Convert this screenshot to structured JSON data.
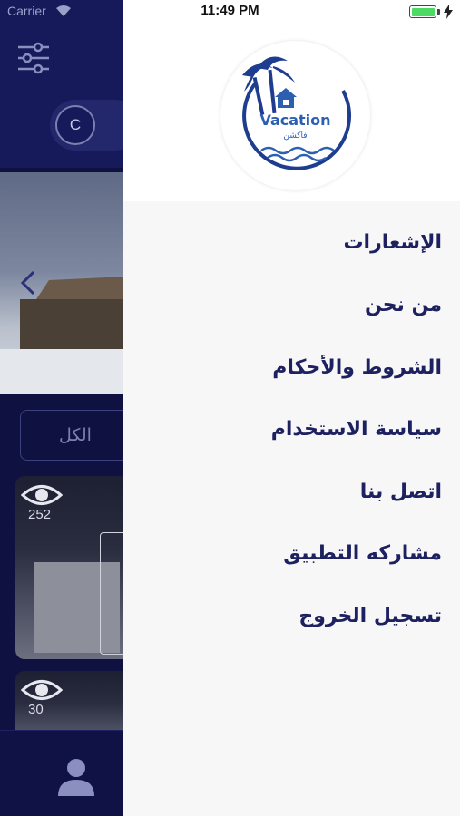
{
  "status_bar": {
    "carrier": "Carrier",
    "time": "11:49 PM",
    "battery_level": 1.0
  },
  "background_app": {
    "currency": "C",
    "filter_all_label": "الكل",
    "cards": [
      {
        "views": "252"
      },
      {
        "views": "30"
      }
    ]
  },
  "logo": {
    "word": "Vacation",
    "arabic": "فاكشن"
  },
  "menu": {
    "items": [
      {
        "label": "الإشعارات"
      },
      {
        "label": "من نحن"
      },
      {
        "label": "الشروط والأحكام"
      },
      {
        "label": "سياسة الاستخدام"
      },
      {
        "label": "اتصل بنا"
      },
      {
        "label": "مشاركه التطبيق"
      },
      {
        "label": "تسجيل الخروج"
      }
    ]
  },
  "colors": {
    "menu_text": "#1e2160",
    "logo_blue": "#2d5fb1",
    "app_navy": "#161a5a"
  }
}
